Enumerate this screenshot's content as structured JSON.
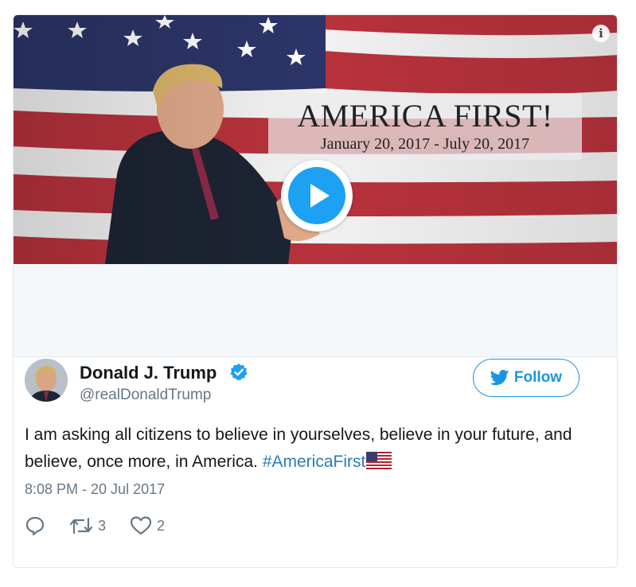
{
  "media": {
    "banner_title": "AMERICA FIRST!",
    "banner_dates": "January 20, 2017 - July 20, 2017",
    "info_symbol": "i",
    "colors": {
      "flag_red": "#b22234",
      "flag_blue": "#3c3b6e",
      "play_blue": "#1da1f2"
    }
  },
  "author": {
    "name": "Donald J. Trump",
    "handle": "@realDonaldTrump",
    "verified": true
  },
  "follow": {
    "label": "Follow"
  },
  "tweet": {
    "text": "I am asking all citizens to believe in yourselves, believe in your future, and believe, once more, in America. ",
    "hashtag": "#AmericaFirst",
    "timestamp": "8:08 PM - 20 Jul 2017"
  },
  "actions": {
    "reply_icon": "reply-icon",
    "retweet_count": "3",
    "like_count": "2"
  },
  "colors": {
    "link": "#2b7bb9",
    "muted": "#657786",
    "follow_blue": "#1b95e0"
  }
}
